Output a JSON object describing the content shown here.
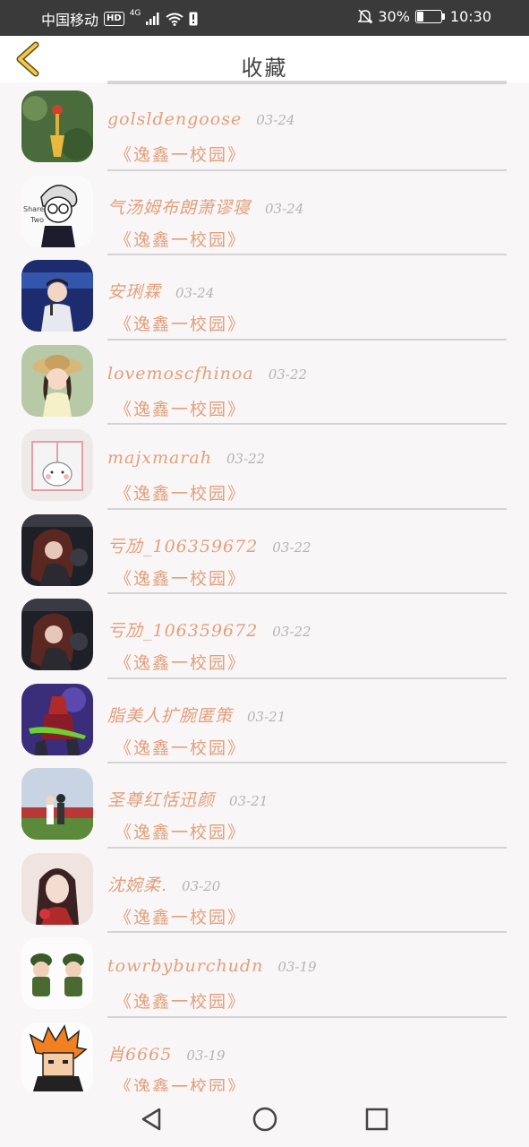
{
  "status_bar": {
    "carrier": "中国移动",
    "hd": "HD",
    "network": "4G",
    "battery_text": "30%",
    "battery_level": 0.3,
    "time": "10:30",
    "icons": [
      "hd-badge-icon",
      "signal-icon",
      "wifi-icon",
      "sim-alert-icon",
      "mute-bell-icon",
      "battery-icon"
    ]
  },
  "header": {
    "title": "收藏",
    "back_icon": "chevron-left-icon"
  },
  "favorites": [
    {
      "name": "golsldengoose",
      "date": "03-24",
      "title": "《逸鑫一校园》",
      "avatar": "tassel-plant"
    },
    {
      "name": "气汤姆布朗萧谬寝",
      "date": "03-24",
      "title": "《逸鑫一校园》",
      "avatar": "cartoon-boy"
    },
    {
      "name": "安琍霖",
      "date": "03-24",
      "title": "《逸鑫一校园》",
      "avatar": "stage-singer"
    },
    {
      "name": "lovemoscfhinoa",
      "date": "03-22",
      "title": "《逸鑫一校园》",
      "avatar": "straw-hat-girl"
    },
    {
      "name": "majxmarah",
      "date": "03-22",
      "title": "《逸鑫一校园》",
      "avatar": "cute-bear-window"
    },
    {
      "name": "亏劢_106359672",
      "date": "03-22",
      "title": "《逸鑫一校园》",
      "avatar": "dark-anime-girl"
    },
    {
      "name": "亏劢_106359672",
      "date": "03-22",
      "title": "《逸鑫一校园》",
      "avatar": "dark-anime-girl"
    },
    {
      "name": "脂美人扩腕匿策",
      "date": "03-21",
      "title": "《逸鑫一校园》",
      "avatar": "game-warrior"
    },
    {
      "name": "圣尊红恬迅颜",
      "date": "03-21",
      "title": "《逸鑫一校园》",
      "avatar": "couple-field"
    },
    {
      "name": "沈婉柔.",
      "date": "03-20",
      "title": "《逸鑫一校园》",
      "avatar": "portrait-woman"
    },
    {
      "name": "towrbyburchudn",
      "date": "03-19",
      "title": "《逸鑫一校园》",
      "avatar": "two-soldiers"
    },
    {
      "name": "肖6665",
      "date": "03-19",
      "title": "《逸鑫一校园》",
      "avatar": "pixel-orange-hair"
    }
  ],
  "nav_bar": {
    "icons": [
      "back-triangle-icon",
      "home-circle-icon",
      "recents-square-icon"
    ]
  }
}
